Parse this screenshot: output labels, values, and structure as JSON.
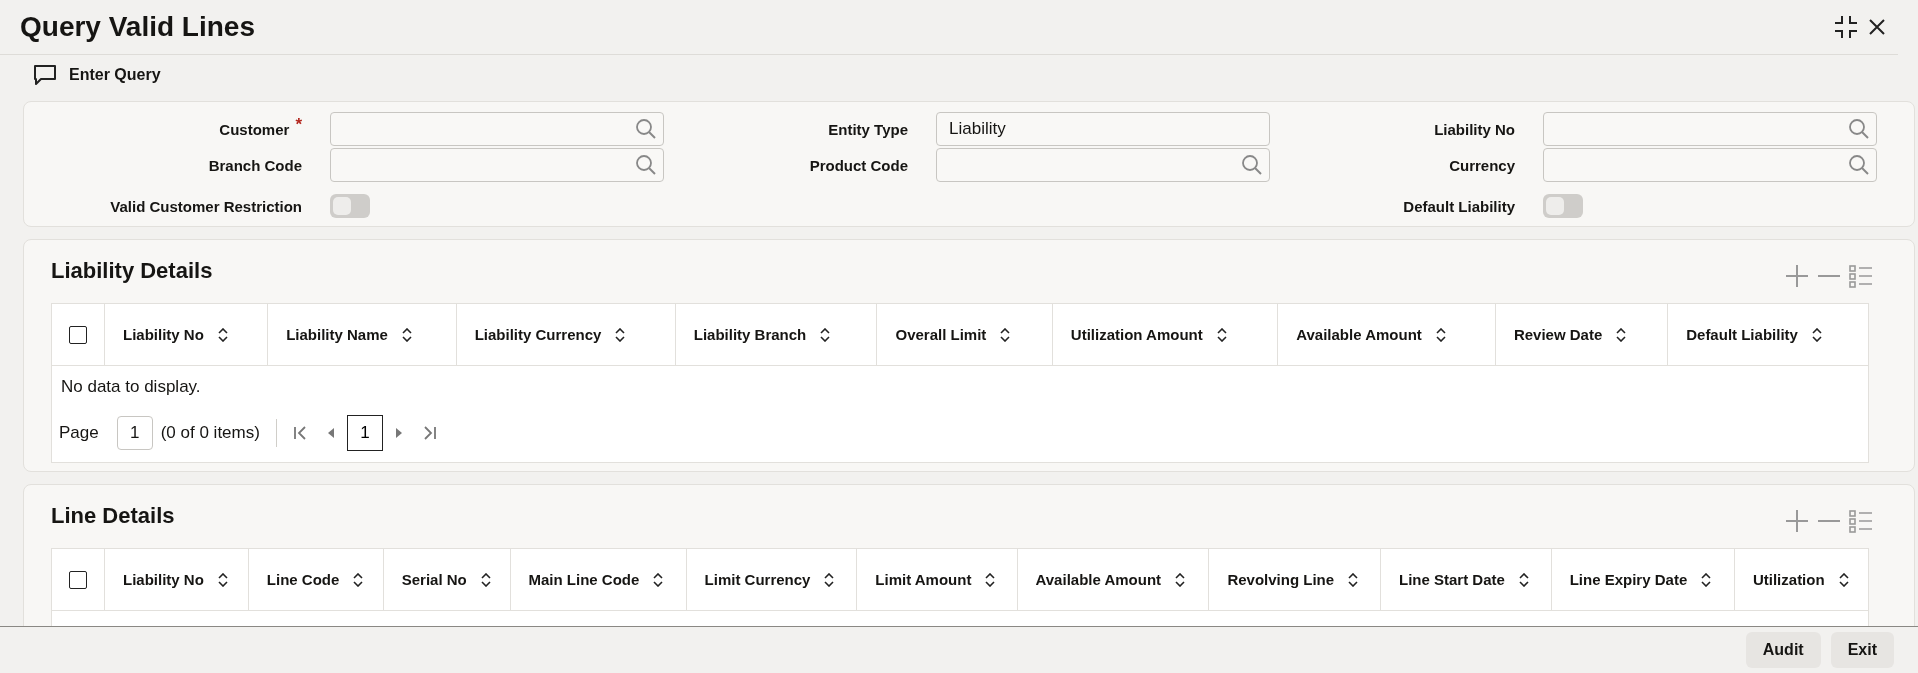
{
  "window": {
    "title": "Query Valid Lines"
  },
  "toolbar": {
    "enter_query": "Enter Query"
  },
  "form": {
    "columns": [
      [
        {
          "label": "Customer",
          "kind": "lookup",
          "marker": "*"
        },
        {
          "label": "Branch Code",
          "kind": "lookup"
        },
        {
          "label": "Valid Customer Restriction",
          "kind": "toggle",
          "on": false
        }
      ],
      [
        {
          "label": "Entity Type",
          "kind": "text",
          "value": "Liability"
        },
        {
          "label": "Product Code",
          "kind": "lookup"
        }
      ],
      [
        {
          "label": "Liability No",
          "kind": "lookup"
        },
        {
          "label": "Currency",
          "kind": "lookup"
        },
        {
          "label": "Default Liability",
          "kind": "toggle",
          "on": false
        }
      ]
    ]
  },
  "sections": [
    {
      "title": "Liability Details",
      "select_all_checked": false,
      "columns": [
        "Liability No",
        "Liability Name",
        "Liability Currency",
        "Liability Branch",
        "Overall Limit",
        "Utilization Amount",
        "Available Amount",
        "Review Date",
        "Default Liability"
      ],
      "empty_message": "No data to display.",
      "pager": {
        "label": "Page",
        "page": "1",
        "summary": "(0 of 0 items)",
        "current": "1"
      }
    },
    {
      "title": "Line Details",
      "select_all_checked": false,
      "columns": [
        "Liability No",
        "Line Code",
        "Serial No",
        "Main Line Code",
        "Limit Currency",
        "Limit Amount",
        "Available Amount",
        "Revolving Line",
        "Line Start Date",
        "Line Expiry Date",
        "Utilization"
      ]
    }
  ],
  "footer": {
    "buttons": [
      "Audit",
      "Exit"
    ]
  }
}
